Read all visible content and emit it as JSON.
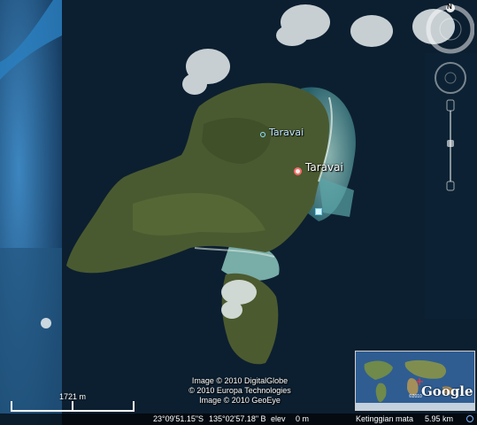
{
  "map": {
    "placemarks": [
      {
        "name": "Taravai",
        "style": "secondary"
      },
      {
        "name": "Taravai",
        "style": "primary"
      }
    ],
    "compass_letter": "N",
    "credits": [
      "Image © 2010 DigitalGlobe",
      "© 2010 Europa Technologies",
      "Image © 2010 GeoEye"
    ],
    "scale_label": "1721 m",
    "colors": {
      "ocean_deep": "#0b1a2a",
      "ocean_shallow": "#2b6fa8",
      "land": "#4a5a30",
      "reef": "#6fb3a4",
      "clouds": "#e8eef0"
    }
  },
  "status_bar": {
    "latitude": "23°09'51.15\"S",
    "longitude": "135°02'57.18\" B",
    "elev_label": "elev",
    "elev_value": "0 m",
    "eye_alt_label": "Ketinggian mata",
    "eye_alt_value": "5.95 km"
  },
  "overview": {
    "brand": "Google",
    "copyright": "©2010"
  }
}
